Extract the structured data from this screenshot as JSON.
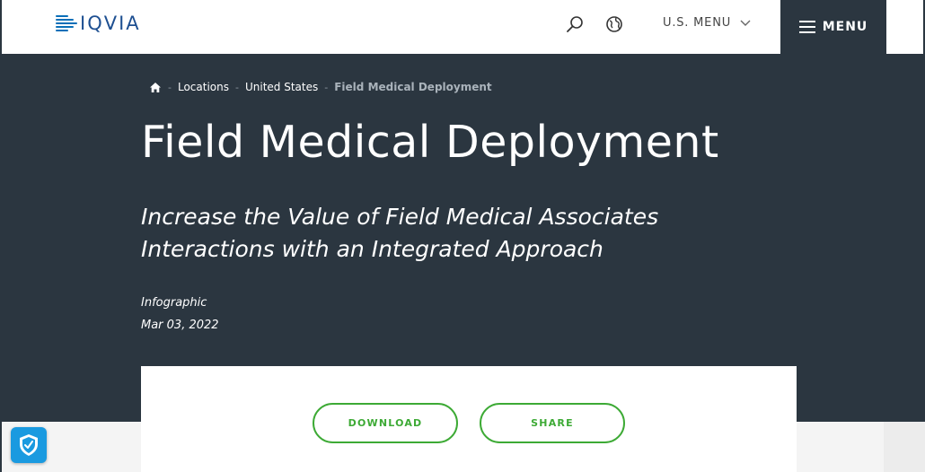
{
  "header": {
    "logo_text": "IQVIA",
    "region_menu_label": "U.S. MENU",
    "menu_label": "MENU"
  },
  "breadcrumb": {
    "items": [
      "Locations",
      "United States"
    ],
    "current": "Field Medical Deployment",
    "separator": "-"
  },
  "hero": {
    "title": "Field Medical Deployment",
    "subtitle": "Increase the Value of Field Medical Associates Interactions with an Integrated Approach",
    "content_type": "Infographic",
    "date": "Mar 03, 2022"
  },
  "actions": {
    "download_label": "DOWNLOAD",
    "share_label": "SHARE"
  },
  "icons": {
    "home": "home-icon",
    "search": "search-icon",
    "globe": "globe-icon",
    "chevron": "chevron-down-icon",
    "hamburger": "hamburger-icon",
    "privacy": "shield-check-icon"
  },
  "colors": {
    "hero_bg": "#2b3640",
    "accent_green": "#3daa35",
    "brand_blue": "#1d4f91",
    "badge_blue": "#1a9ae0"
  }
}
